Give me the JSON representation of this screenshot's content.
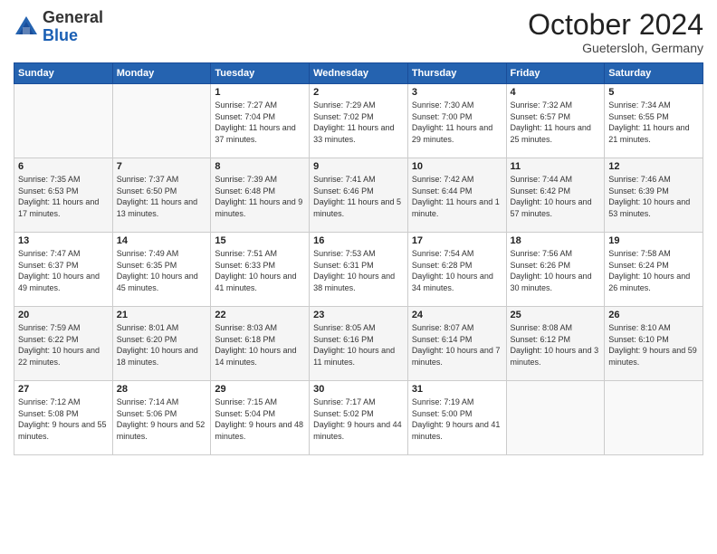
{
  "header": {
    "logo_general": "General",
    "logo_blue": "Blue",
    "month_title": "October 2024",
    "subtitle": "Guetersloh, Germany"
  },
  "weekdays": [
    "Sunday",
    "Monday",
    "Tuesday",
    "Wednesday",
    "Thursday",
    "Friday",
    "Saturday"
  ],
  "weeks": [
    [
      {
        "day": "",
        "info": ""
      },
      {
        "day": "",
        "info": ""
      },
      {
        "day": "1",
        "info": "Sunrise: 7:27 AM\nSunset: 7:04 PM\nDaylight: 11 hours and 37 minutes."
      },
      {
        "day": "2",
        "info": "Sunrise: 7:29 AM\nSunset: 7:02 PM\nDaylight: 11 hours and 33 minutes."
      },
      {
        "day": "3",
        "info": "Sunrise: 7:30 AM\nSunset: 7:00 PM\nDaylight: 11 hours and 29 minutes."
      },
      {
        "day": "4",
        "info": "Sunrise: 7:32 AM\nSunset: 6:57 PM\nDaylight: 11 hours and 25 minutes."
      },
      {
        "day": "5",
        "info": "Sunrise: 7:34 AM\nSunset: 6:55 PM\nDaylight: 11 hours and 21 minutes."
      }
    ],
    [
      {
        "day": "6",
        "info": "Sunrise: 7:35 AM\nSunset: 6:53 PM\nDaylight: 11 hours and 17 minutes."
      },
      {
        "day": "7",
        "info": "Sunrise: 7:37 AM\nSunset: 6:50 PM\nDaylight: 11 hours and 13 minutes."
      },
      {
        "day": "8",
        "info": "Sunrise: 7:39 AM\nSunset: 6:48 PM\nDaylight: 11 hours and 9 minutes."
      },
      {
        "day": "9",
        "info": "Sunrise: 7:41 AM\nSunset: 6:46 PM\nDaylight: 11 hours and 5 minutes."
      },
      {
        "day": "10",
        "info": "Sunrise: 7:42 AM\nSunset: 6:44 PM\nDaylight: 11 hours and 1 minute."
      },
      {
        "day": "11",
        "info": "Sunrise: 7:44 AM\nSunset: 6:42 PM\nDaylight: 10 hours and 57 minutes."
      },
      {
        "day": "12",
        "info": "Sunrise: 7:46 AM\nSunset: 6:39 PM\nDaylight: 10 hours and 53 minutes."
      }
    ],
    [
      {
        "day": "13",
        "info": "Sunrise: 7:47 AM\nSunset: 6:37 PM\nDaylight: 10 hours and 49 minutes."
      },
      {
        "day": "14",
        "info": "Sunrise: 7:49 AM\nSunset: 6:35 PM\nDaylight: 10 hours and 45 minutes."
      },
      {
        "day": "15",
        "info": "Sunrise: 7:51 AM\nSunset: 6:33 PM\nDaylight: 10 hours and 41 minutes."
      },
      {
        "day": "16",
        "info": "Sunrise: 7:53 AM\nSunset: 6:31 PM\nDaylight: 10 hours and 38 minutes."
      },
      {
        "day": "17",
        "info": "Sunrise: 7:54 AM\nSunset: 6:28 PM\nDaylight: 10 hours and 34 minutes."
      },
      {
        "day": "18",
        "info": "Sunrise: 7:56 AM\nSunset: 6:26 PM\nDaylight: 10 hours and 30 minutes."
      },
      {
        "day": "19",
        "info": "Sunrise: 7:58 AM\nSunset: 6:24 PM\nDaylight: 10 hours and 26 minutes."
      }
    ],
    [
      {
        "day": "20",
        "info": "Sunrise: 7:59 AM\nSunset: 6:22 PM\nDaylight: 10 hours and 22 minutes."
      },
      {
        "day": "21",
        "info": "Sunrise: 8:01 AM\nSunset: 6:20 PM\nDaylight: 10 hours and 18 minutes."
      },
      {
        "day": "22",
        "info": "Sunrise: 8:03 AM\nSunset: 6:18 PM\nDaylight: 10 hours and 14 minutes."
      },
      {
        "day": "23",
        "info": "Sunrise: 8:05 AM\nSunset: 6:16 PM\nDaylight: 10 hours and 11 minutes."
      },
      {
        "day": "24",
        "info": "Sunrise: 8:07 AM\nSunset: 6:14 PM\nDaylight: 10 hours and 7 minutes."
      },
      {
        "day": "25",
        "info": "Sunrise: 8:08 AM\nSunset: 6:12 PM\nDaylight: 10 hours and 3 minutes."
      },
      {
        "day": "26",
        "info": "Sunrise: 8:10 AM\nSunset: 6:10 PM\nDaylight: 9 hours and 59 minutes."
      }
    ],
    [
      {
        "day": "27",
        "info": "Sunrise: 7:12 AM\nSunset: 5:08 PM\nDaylight: 9 hours and 55 minutes."
      },
      {
        "day": "28",
        "info": "Sunrise: 7:14 AM\nSunset: 5:06 PM\nDaylight: 9 hours and 52 minutes."
      },
      {
        "day": "29",
        "info": "Sunrise: 7:15 AM\nSunset: 5:04 PM\nDaylight: 9 hours and 48 minutes."
      },
      {
        "day": "30",
        "info": "Sunrise: 7:17 AM\nSunset: 5:02 PM\nDaylight: 9 hours and 44 minutes."
      },
      {
        "day": "31",
        "info": "Sunrise: 7:19 AM\nSunset: 5:00 PM\nDaylight: 9 hours and 41 minutes."
      },
      {
        "day": "",
        "info": ""
      },
      {
        "day": "",
        "info": ""
      }
    ]
  ]
}
